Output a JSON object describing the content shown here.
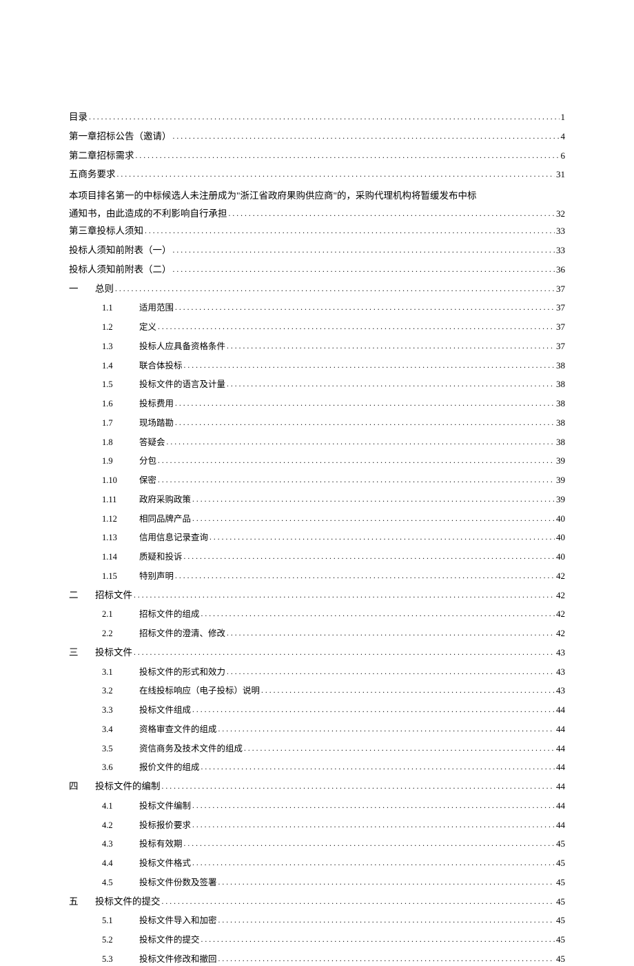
{
  "toc": [
    {
      "level": 0,
      "num": "",
      "title": "目录",
      "page": "1"
    },
    {
      "level": 0,
      "num": "",
      "title": "第一章招标公告（邀请）",
      "page": "4"
    },
    {
      "level": 0,
      "num": "",
      "title": "第二章招标需求",
      "page": "6"
    },
    {
      "level": 0,
      "num": "",
      "title": "五商务要求",
      "page": "31"
    },
    {
      "level": 0,
      "num": "",
      "multiline": true,
      "title_pre": "本项目排名第一的中标候选人未注册成为\"浙江省政府果购供应商\"的，采购代理机构将暂缓发布中标",
      "title_last": "通知书，由此造成的不利影响自行承担",
      "page": "32"
    },
    {
      "level": 0,
      "num": "",
      "title": "第三章投标人须知",
      "page": "33"
    },
    {
      "level": 0,
      "num": "",
      "title": "投标人须知前附表（一）",
      "page": "33"
    },
    {
      "level": 0,
      "num": "",
      "title": "投标人须知前附表（二）",
      "page": "36"
    },
    {
      "level": 1,
      "num": "一",
      "title": "总则",
      "page": "37"
    },
    {
      "level": 2,
      "num": "1.1",
      "title": "适用范围",
      "page": "37"
    },
    {
      "level": 2,
      "num": "1.2",
      "title": "定义",
      "page": "37"
    },
    {
      "level": 2,
      "num": "1.3",
      "title": "投标人应具备资格条件",
      "page": "37"
    },
    {
      "level": 2,
      "num": "1.4",
      "title": "联合体投标",
      "page": "38"
    },
    {
      "level": 2,
      "num": "1.5",
      "title": "投标文件的语言及计量",
      "page": "38"
    },
    {
      "level": 2,
      "num": "1.6",
      "title": "投标费用",
      "page": "38"
    },
    {
      "level": 2,
      "num": "1.7",
      "title": "现场踏勘",
      "page": "38"
    },
    {
      "level": 2,
      "num": "1.8",
      "title": "答疑会",
      "page": "38"
    },
    {
      "level": 2,
      "num": "1.9",
      "title": "分包",
      "page": "39"
    },
    {
      "level": 2,
      "num": "1.10",
      "title": "保密",
      "page": "39"
    },
    {
      "level": 2,
      "num": "1.11",
      "title": "政府采购政策",
      "page": "39"
    },
    {
      "level": 2,
      "num": "1.12",
      "title": "相同品牌产品",
      "page": "40"
    },
    {
      "level": 2,
      "num": "1.13",
      "title": "信用信息记录查询",
      "page": "40"
    },
    {
      "level": 2,
      "num": "1.14",
      "title": "质疑和投诉",
      "page": "40"
    },
    {
      "level": 2,
      "num": "1.15",
      "title": "特别声明",
      "page": "42"
    },
    {
      "level": 1,
      "num": "二",
      "title": "招标文件",
      "page": "42"
    },
    {
      "level": 2,
      "num": "2.1",
      "title": "招标文件的组成",
      "page": "42"
    },
    {
      "level": 2,
      "num": "2.2",
      "title": "招标文件的澄清、修改",
      "page": "42"
    },
    {
      "level": 1,
      "num": "三",
      "title": "投标文件",
      "page": "43"
    },
    {
      "level": 2,
      "num": "3.1",
      "title": "投标文件的形式和效力",
      "page": "43"
    },
    {
      "level": 2,
      "num": "3.2",
      "title": "在线投标响应（电子投标）说明",
      "page": "43"
    },
    {
      "level": 2,
      "num": "3.3",
      "title": "投标文件组成",
      "page": "44"
    },
    {
      "level": 2,
      "num": "3.4",
      "title": "资格审查文件的组成",
      "page": "44"
    },
    {
      "level": 2,
      "num": "3.5",
      "title": "资信商务及技术文件的组成",
      "page": "44"
    },
    {
      "level": 2,
      "num": "3.6",
      "title": "报价文件的组成",
      "page": "44"
    },
    {
      "level": 1,
      "num": "四",
      "title": "投标文件的编制",
      "page": "44"
    },
    {
      "level": 2,
      "num": "4.1",
      "title": "投标文件编制",
      "page": "44"
    },
    {
      "level": 2,
      "num": "4.2",
      "title": "投标报价要求",
      "page": "44"
    },
    {
      "level": 2,
      "num": "4.3",
      "title": "投标有效期",
      "page": "45"
    },
    {
      "level": 2,
      "num": "4.4",
      "title": "投标文件格式",
      "page": "45"
    },
    {
      "level": 2,
      "num": "4.5",
      "title": "投标文件份数及签署",
      "page": "45"
    },
    {
      "level": 1,
      "num": "五",
      "title": "投标文件的提交",
      "page": "45"
    },
    {
      "level": 2,
      "num": "5.1",
      "title": "投标文件导入和加密",
      "page": "45"
    },
    {
      "level": 2,
      "num": "5.2",
      "title": "投标文件的提交",
      "page": "45"
    },
    {
      "level": 2,
      "num": "5.3",
      "title": "投标文件修改和撤回",
      "page": "45"
    }
  ],
  "dots": "...................................................................................................................................."
}
